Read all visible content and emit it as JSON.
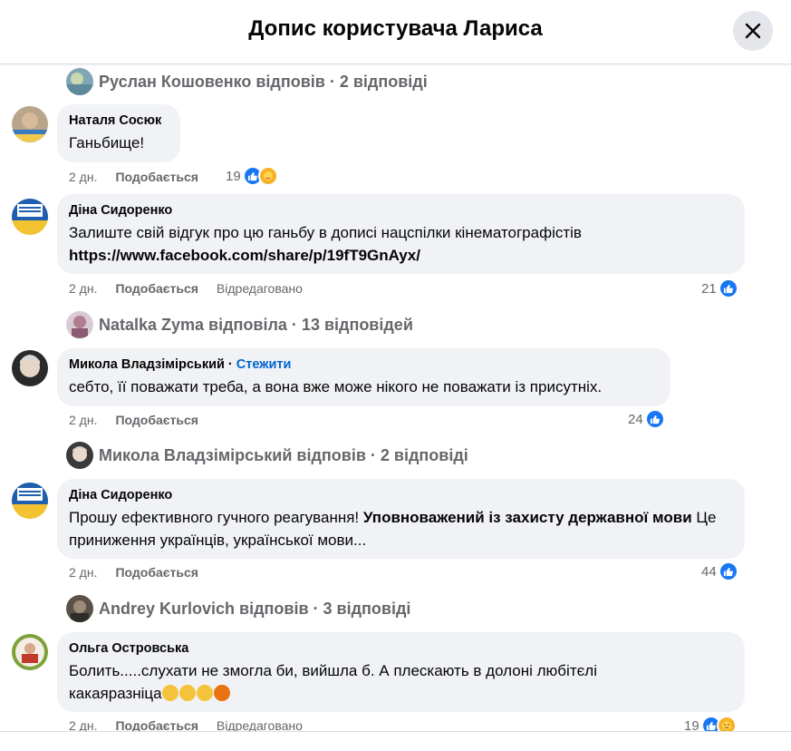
{
  "dialog": {
    "title": "Допис користувача Лариса"
  },
  "colors": {
    "accent": "#1877f2",
    "bubble": "#f0f2f5",
    "meta": "#65676b",
    "link": "#0064d1"
  },
  "thread": [
    {
      "type": "summary",
      "text": "Руслан Кошовенко відповів · 2 відповіді"
    },
    {
      "type": "comment",
      "author": "Наталя Сосюк",
      "text": "Ганьбище!",
      "time": "2 дн.",
      "like": "Подобається",
      "reactions": "19",
      "reaction_icons": [
        "like-icon",
        "care-icon"
      ]
    },
    {
      "type": "comment",
      "author": "Діна Сидоренко",
      "text": "Залиште свій відгук про цю ганьбу в дописі нацспілки кінематографістів",
      "link": "https://www.facebook.com/share/p/19fT9GnAyx/",
      "time": "2 дн.",
      "like": "Подобається",
      "edited": "Відредаговано",
      "reactions": "21",
      "reaction_icons": [
        "like-icon"
      ]
    },
    {
      "type": "summary",
      "text": "Natalka Zyma відповіла · 13 відповідей"
    },
    {
      "type": "comment",
      "author": "Микола Владзімірський",
      "follow": "Стежити",
      "text": "себто, її поважати треба, а вона вже може нікого не поважати із присутніх.",
      "time": "2 дн.",
      "like": "Подобається",
      "reactions": "24",
      "reaction_icons": [
        "like-icon"
      ]
    },
    {
      "type": "summary",
      "text": "Микола Владзімірський відповів · 2 відповіді"
    },
    {
      "type": "comment",
      "author": "Діна Сидоренко",
      "text_before": "Прошу ефективного гучного реагування! ",
      "text_bold": "Уповноважений із захисту державної мови",
      "text_after": " Це приниження українців, української мови...",
      "time": "2 дн.",
      "like": "Подобається",
      "reactions": "44",
      "reaction_icons": [
        "like-icon"
      ]
    },
    {
      "type": "summary",
      "text": "Andrey Kurlovich відповів · 3 відповіді"
    },
    {
      "type": "comment",
      "author": "Ольга Островська",
      "text_line1": "Болить.....слухати не змогла би, вийшла б. А плескають в долоні любітєлі",
      "text_line2": "какаяразніца",
      "emojis": [
        "sad-face-icon",
        "sad-face-icon",
        "sad-face-icon",
        "angry-face-icon"
      ],
      "time": "2 дн.",
      "like": "Подобається",
      "edited": "Відредаговано",
      "reactions": "19",
      "reaction_icons": [
        "like-icon",
        "sad-icon"
      ]
    }
  ]
}
